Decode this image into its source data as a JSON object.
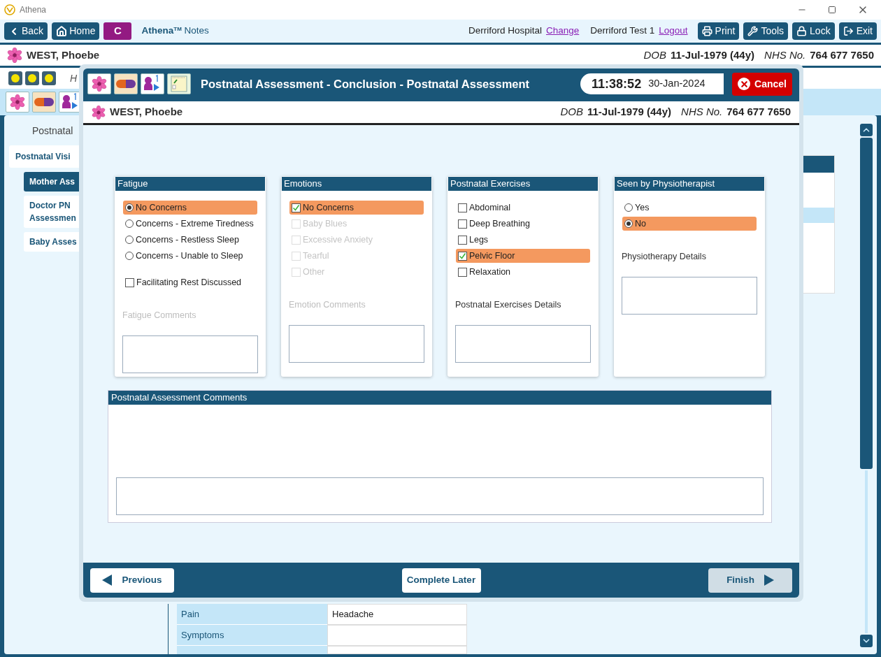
{
  "app": {
    "title": "Athena"
  },
  "toolbar": {
    "nav_buttons": [
      {
        "kind": "back",
        "label": "Back"
      },
      {
        "kind": "home",
        "label": "Home"
      }
    ],
    "letter": "C",
    "brand": "Athena",
    "brand_mark": "TM",
    "brand_suffix": "Notes",
    "hospital": "Derriford Hospital",
    "change_link": "Change",
    "user": "Derriford Test 1",
    "logout_link": "Logout",
    "actions": [
      {
        "kind": "print",
        "label": "Print"
      },
      {
        "kind": "tools",
        "label": "Tools"
      },
      {
        "kind": "lock",
        "label": "Lock"
      },
      {
        "kind": "exit",
        "label": "Exit"
      }
    ]
  },
  "patient": {
    "name": "WEST, Phoebe",
    "dob_label": "DOB",
    "dob": "11-Jul-1979 (44y)",
    "nhs_label": "NHS No.",
    "nhs": "764 677 7650"
  },
  "subheader_text": "H",
  "nav": {
    "heading": "Postnatal",
    "items": [
      {
        "label": "Postnatal Visi",
        "selected": false,
        "children": [
          {
            "label": "Mother Ass",
            "selected": true
          },
          {
            "label": "Doctor PN\nAssessmen",
            "selected": false
          },
          {
            "label": "Baby Asses",
            "selected": false
          }
        ]
      }
    ]
  },
  "table_rows": [
    {
      "label": "Pain",
      "value": "Headache"
    },
    {
      "label": "Symptoms",
      "value": ""
    }
  ],
  "dialog": {
    "title": "Postnatal Assessment - Conclusion - Postnatal Assessment",
    "time": "11:38:52",
    "date": "30-Jan-2024",
    "cancel": "Cancel",
    "patient": {
      "name": "WEST, Phoebe",
      "dob_label": "DOB",
      "dob": "11-Jul-1979 (44y)",
      "nhs_label": "NHS No.",
      "nhs": "764 677 7650"
    },
    "sections": [
      {
        "title": "Fatigue",
        "items": [
          {
            "kind": "radio",
            "label": "No Concerns",
            "selected": true,
            "disabled": false
          },
          {
            "kind": "radio",
            "label": "Concerns - Extreme Tiredness",
            "selected": false,
            "disabled": false
          },
          {
            "kind": "radio",
            "label": "Concerns - Restless Sleep",
            "selected": false,
            "disabled": false
          },
          {
            "kind": "radio",
            "label": "Concerns - Unable to Sleep",
            "selected": false,
            "disabled": false
          }
        ],
        "extra": {
          "kind": "checkbox",
          "label": "Facilitating Rest Discussed",
          "checked": false
        },
        "details_label": "Fatigue Comments",
        "details_disabled": true
      },
      {
        "title": "Emotions",
        "items": [
          {
            "kind": "checkbox",
            "label": "No Concerns",
            "checked": true,
            "disabled": false
          },
          {
            "kind": "checkbox",
            "label": "Baby Blues",
            "checked": false,
            "disabled": true
          },
          {
            "kind": "checkbox",
            "label": "Excessive Anxiety",
            "checked": false,
            "disabled": true
          },
          {
            "kind": "checkbox",
            "label": "Tearful",
            "checked": false,
            "disabled": true
          },
          {
            "kind": "checkbox",
            "label": "Other",
            "checked": false,
            "disabled": true
          }
        ],
        "details_label": "Emotion Comments",
        "details_disabled": true
      },
      {
        "title": "Postnatal Exercises",
        "items": [
          {
            "kind": "checkbox",
            "label": "Abdominal",
            "checked": false,
            "disabled": false
          },
          {
            "kind": "checkbox",
            "label": "Deep Breathing",
            "checked": false,
            "disabled": false
          },
          {
            "kind": "checkbox",
            "label": "Legs",
            "checked": false,
            "disabled": false
          },
          {
            "kind": "checkbox",
            "label": "Pelvic Floor",
            "checked": true,
            "disabled": false
          },
          {
            "kind": "checkbox",
            "label": "Relaxation",
            "checked": false,
            "disabled": false
          }
        ],
        "details_label": "Postnatal Exercises Details",
        "details_disabled": false
      },
      {
        "title": "Seen by Physiotherapist",
        "items": [
          {
            "kind": "radio",
            "label": "Yes",
            "selected": false,
            "disabled": false
          },
          {
            "kind": "radio",
            "label": "No",
            "selected": true,
            "disabled": false
          }
        ],
        "details_label": "Physiotherapy Details",
        "details_disabled": false
      }
    ],
    "comments_title": "Postnatal Assessment Comments",
    "footer": {
      "previous": "Previous",
      "complete_later": "Complete Later",
      "finish": "Finish",
      "finish_disabled": true
    }
  }
}
